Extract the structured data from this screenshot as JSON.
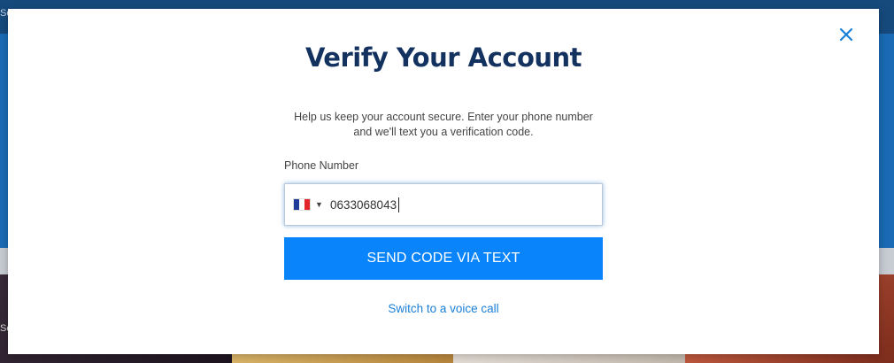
{
  "background": {
    "topbar_text": "Se",
    "side_text": "Se"
  },
  "modal": {
    "title": "Verify Your Account",
    "description": "Help us keep your account secure. Enter your phone number and we'll text you a verification code.",
    "phone_label": "Phone Number",
    "phone_value": "0633068043",
    "country_flag": "france-flag-icon",
    "send_button_label": "SEND CODE VIA TEXT",
    "switch_link_label": "Switch to a voice call",
    "close_icon": "close-icon"
  },
  "colors": {
    "title": "#13325f",
    "button": "#0a84fb",
    "link": "#1a7fd6",
    "close": "#1a7fd6"
  }
}
